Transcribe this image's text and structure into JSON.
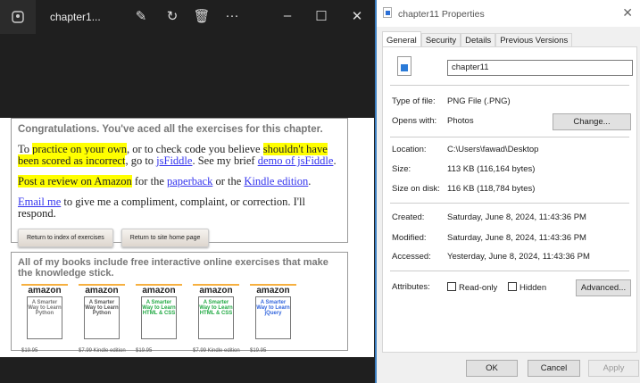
{
  "photos": {
    "title": "chapter1...",
    "icons": [
      "photos-app-icon",
      "edit-image-icon",
      "rotate-icon",
      "delete-icon",
      "more-icon"
    ],
    "window_controls": [
      "minimize",
      "maximize",
      "close"
    ],
    "image": {
      "box1": {
        "heading": "Congratulations. You've aced all the exercises for this chapter.",
        "p1": {
          "a": "To ",
          "b": "practice on your own",
          "c": ", or to check code you believe ",
          "d": "shouldn't have been scored as incorrect",
          "e": ", go to ",
          "f": "jsFiddle",
          "g": ". See my brief ",
          "h": "demo of jsFiddle",
          "i": "."
        },
        "p2": {
          "a": "Post a review on Amazon",
          "b": " for the ",
          "c": "paperback",
          "d": " or the ",
          "e": "Kindle edition",
          "f": "."
        },
        "p3": {
          "a": "Email me",
          "b": " to give me a compliment, complaint, or correction. I'll respond."
        },
        "btn1": "Return to index of exercises",
        "btn2": "Return to site home page"
      },
      "box2": {
        "heading": "All of my books include free interactive online exercises that make the knowledge stick.",
        "books": [
          {
            "brand": "amazon",
            "title": "A Smarter Way to Learn Python",
            "price": "$19.95",
            "color": "#777777"
          },
          {
            "brand": "amazon",
            "title": "A Smarter Way to Learn Python",
            "price": "$7.99 Kindle edition",
            "color": "#555555"
          },
          {
            "brand": "amazon",
            "title": "A Smarter Way to Learn HTML & CSS",
            "price": "$19.95",
            "color": "#22aa44"
          },
          {
            "brand": "amazon",
            "title": "A Smarter Way to Learn HTML & CSS",
            "price": "$7.99 Kindle edition",
            "color": "#22aa44"
          },
          {
            "brand": "amazon",
            "title": "A Smarter Way to Learn jQuery",
            "price": "$19.95",
            "color": "#3366dd"
          }
        ]
      }
    }
  },
  "dialog": {
    "title": "chapter11 Properties",
    "tabs": [
      "General",
      "Security",
      "Details",
      "Previous Versions"
    ],
    "filename": "chapter11",
    "type_label": "Type of file:",
    "type": "PNG File (.PNG)",
    "opens_label": "Opens with:",
    "opens": "Photos",
    "change": "Change...",
    "location_label": "Location:",
    "location": "C:\\Users\\fawad\\Desktop",
    "size_label": "Size:",
    "size": "113 KB (116,164 bytes)",
    "disk_label": "Size on disk:",
    "disk": "116 KB (118,784 bytes)",
    "created_label": "Created:",
    "created": "Saturday, June 8, 2024, 11:43:36 PM",
    "modified_label": "Modified:",
    "modified": "Saturday, June 8, 2024, 11:43:36 PM",
    "accessed_label": "Accessed:",
    "accessed": "Yesterday, June 8, 2024, 11:43:36 PM",
    "attributes_label": "Attributes:",
    "readonly": "Read-only",
    "hidden": "Hidden",
    "advanced": "Advanced...",
    "ok": "OK",
    "cancel": "Cancel",
    "apply": "Apply"
  }
}
